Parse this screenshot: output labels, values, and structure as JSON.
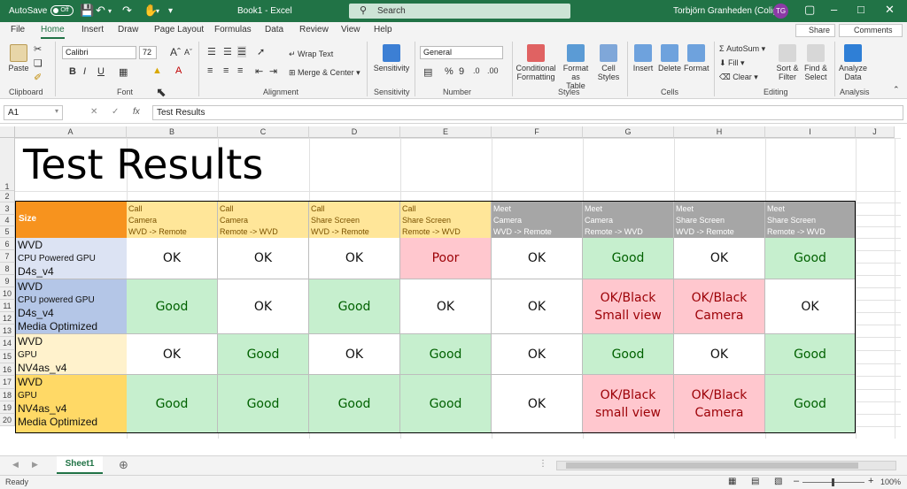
{
  "titlebar": {
    "autosave_label": "AutoSave",
    "autosave_state": "Off",
    "doc_title": "Book1 - Excel",
    "search_placeholder": "Search",
    "user_name": "Torbjörn Granheden (Coligo)",
    "user_initials": "TG"
  },
  "menu": {
    "tabs": [
      "File",
      "Home",
      "Insert",
      "Draw",
      "Page Layout",
      "Formulas",
      "Data",
      "Review",
      "View",
      "Help"
    ],
    "active": "Home",
    "share_label": "Share",
    "comments_label": "Comments"
  },
  "ribbon": {
    "clipboard": {
      "paste": "Paste",
      "group": "Clipboard"
    },
    "font": {
      "name": "Calibri",
      "size": "72",
      "group": "Font"
    },
    "alignment": {
      "wrap": "Wrap Text",
      "merge": "Merge & Center",
      "group": "Alignment"
    },
    "sensitivity": {
      "label": "Sensitivity",
      "group": "Sensitivity"
    },
    "number": {
      "format": "General",
      "group": "Number"
    },
    "styles": {
      "conditional_1": "Conditional",
      "conditional_2": "Formatting",
      "format_table_1": "Format as",
      "format_table_2": "Table",
      "cell_styles_1": "Cell",
      "cell_styles_2": "Styles",
      "group": "Styles"
    },
    "cells": {
      "insert": "Insert",
      "delete": "Delete",
      "format": "Format",
      "group": "Cells"
    },
    "editing": {
      "autosum": "AutoSum",
      "fill": "Fill",
      "clear": "Clear",
      "sort_1": "Sort &",
      "sort_2": "Filter",
      "find_1": "Find &",
      "find_2": "Select",
      "group": "Editing"
    },
    "analysis": {
      "analyze_1": "Analyze",
      "analyze_2": "Data",
      "group": "Analysis"
    }
  },
  "formula_bar": {
    "name_box": "A1",
    "fx": "fx",
    "content": "Test Results"
  },
  "sheet": {
    "columns": [
      "A",
      "B",
      "C",
      "D",
      "E",
      "F",
      "G",
      "H",
      "I",
      "J"
    ],
    "rows": [
      "1",
      "2",
      "3",
      "4",
      "5",
      "6",
      "7",
      "8",
      "9",
      "10",
      "11",
      "12",
      "13",
      "14",
      "15",
      "16",
      "17",
      "18",
      "19",
      "20"
    ],
    "title": "Test Results",
    "size_header": "Size",
    "col_headers": [
      {
        "l1": "Call",
        "l2": "Camera",
        "l3": "WVD -> Remote",
        "kind": "call"
      },
      {
        "l1": "Call",
        "l2": "Camera",
        "l3": "Remote -> WVD",
        "kind": "call"
      },
      {
        "l1": "Call",
        "l2": "Share Screen",
        "l3": "WVD -> Remote",
        "kind": "call"
      },
      {
        "l1": "Call",
        "l2": "Share Screen",
        "l3": "Remote -> WVD",
        "kind": "call"
      },
      {
        "l1": "Meet",
        "l2": "Camera",
        "l3": "WVD -> Remote",
        "kind": "meet"
      },
      {
        "l1": "Meet",
        "l2": "Camera",
        "l3": "Remote -> WVD",
        "kind": "meet"
      },
      {
        "l1": "Meet",
        "l2": "Share Screen",
        "l3": "WVD -> Remote",
        "kind": "meet"
      },
      {
        "l1": "Meet",
        "l2": "Share Screen",
        "l3": "Remote -> WVD",
        "kind": "meet"
      }
    ],
    "rows_data": [
      {
        "label": [
          "WVD",
          "CPU Powered GPU",
          "D4s_v4"
        ],
        "label_color": "#dce3f3",
        "results": [
          {
            "text": "OK",
            "status": "ok"
          },
          {
            "text": "OK",
            "status": "ok"
          },
          {
            "text": "OK",
            "status": "ok"
          },
          {
            "text": "Poor",
            "status": "poor"
          },
          {
            "text": "OK",
            "status": "ok"
          },
          {
            "text": "Good",
            "status": "good"
          },
          {
            "text": "OK",
            "status": "ok"
          },
          {
            "text": "Good",
            "status": "good"
          }
        ]
      },
      {
        "label": [
          "WVD",
          "CPU powered GPU",
          "D4s_v4",
          "Media Optimized"
        ],
        "label_color": "#b4c6e7",
        "results": [
          {
            "text": "Good",
            "status": "good"
          },
          {
            "text": "OK",
            "status": "ok"
          },
          {
            "text": "Good",
            "status": "good"
          },
          {
            "text": "OK",
            "status": "ok"
          },
          {
            "text": "OK",
            "status": "ok"
          },
          {
            "text": "OK/Black\nSmall view",
            "status": "poor"
          },
          {
            "text": "OK/Black\nCamera",
            "status": "poor"
          },
          {
            "text": "OK",
            "status": "ok"
          }
        ]
      },
      {
        "label": [
          "WVD",
          "GPU",
          "NV4as_v4"
        ],
        "label_color": "#fff2cc",
        "results": [
          {
            "text": "OK",
            "status": "ok"
          },
          {
            "text": "Good",
            "status": "good"
          },
          {
            "text": "OK",
            "status": "ok"
          },
          {
            "text": "Good",
            "status": "good"
          },
          {
            "text": "OK",
            "status": "ok"
          },
          {
            "text": "Good",
            "status": "good"
          },
          {
            "text": "OK",
            "status": "ok"
          },
          {
            "text": "Good",
            "status": "good"
          }
        ]
      },
      {
        "label": [
          "WVD",
          "GPU",
          "NV4as_v4",
          "Media Optimized"
        ],
        "label_color": "#ffd966",
        "results": [
          {
            "text": "Good",
            "status": "good"
          },
          {
            "text": "Good",
            "status": "good"
          },
          {
            "text": "Good",
            "status": "good"
          },
          {
            "text": "Good",
            "status": "good"
          },
          {
            "text": "OK",
            "status": "ok"
          },
          {
            "text": "OK/Black\nsmall view",
            "status": "poor"
          },
          {
            "text": "OK/Black\nCamera",
            "status": "poor"
          },
          {
            "text": "Good",
            "status": "good"
          }
        ]
      }
    ]
  },
  "sheet_tabs": {
    "active": "Sheet1"
  },
  "status": {
    "ready": "Ready",
    "zoom": "100%"
  },
  "colors": {
    "excel_green": "#217346",
    "size_orange": "#f7931e",
    "call_yellow": "#ffe699",
    "meet_gray": "#a6a6a6",
    "good_bg": "#c6efce",
    "good_fg": "#006100",
    "poor_bg": "#ffc7ce",
    "poor_fg": "#9c0006"
  }
}
